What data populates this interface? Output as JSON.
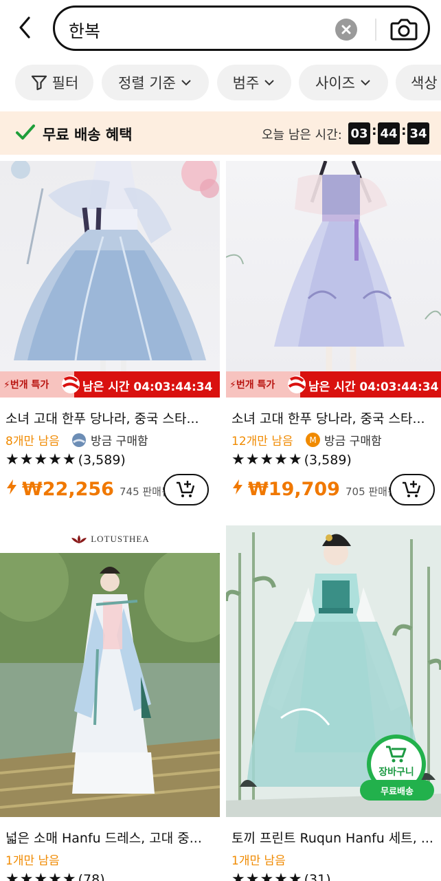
{
  "search": {
    "query": "한복"
  },
  "filters": [
    {
      "label": "필터",
      "icon": "funnel-icon"
    },
    {
      "label": "정렬 기준"
    },
    {
      "label": "범주"
    },
    {
      "label": "사이즈"
    },
    {
      "label": "색상"
    }
  ],
  "shipping": {
    "label": "무료 배송 혜택",
    "timer_label": "오늘 남은 시간:",
    "hours": "03",
    "minutes": "44",
    "seconds": "34"
  },
  "products": [
    {
      "flash_label": "⚡번개 특가",
      "timer_text": "남은 시간 04:03:44:34",
      "title": "소녀 고대 한푸 당나라, 중국 스타...",
      "stock": "8개만 남음",
      "buyer": "방금 구매함",
      "rating_count": "(3,589)",
      "price": "₩22,256",
      "sold": "745 판매됨"
    },
    {
      "flash_label": "⚡번개 특가",
      "timer_text": "남은 시간 04:03:44:34",
      "title": "소녀 고대 한푸 당나라, 중국 스타...",
      "stock": "12개만 남음",
      "buyer": "방금 구매함",
      "buyer_badge": "M",
      "rating_count": "(3,589)",
      "price": "₩19,709",
      "sold": "705 판매됨"
    },
    {
      "brand": "LOTUSTHEA",
      "title": "넓은 소매 Hanfu 드레스, 고대 중...",
      "stock": "1개만 남음",
      "rating_count": "(78)"
    },
    {
      "title": "토끼 프린트 Ruqun Hanfu 세트, ...",
      "stock": "1개만 남음",
      "rating_count": "(31)"
    }
  ],
  "floating_cart": {
    "label": "장바구니",
    "badge": "무료배송"
  },
  "colors": {
    "accent": "#f07800",
    "flash_red": "#d9110f",
    "ship_bg": "#fdeee0",
    "green": "#22b14c"
  }
}
